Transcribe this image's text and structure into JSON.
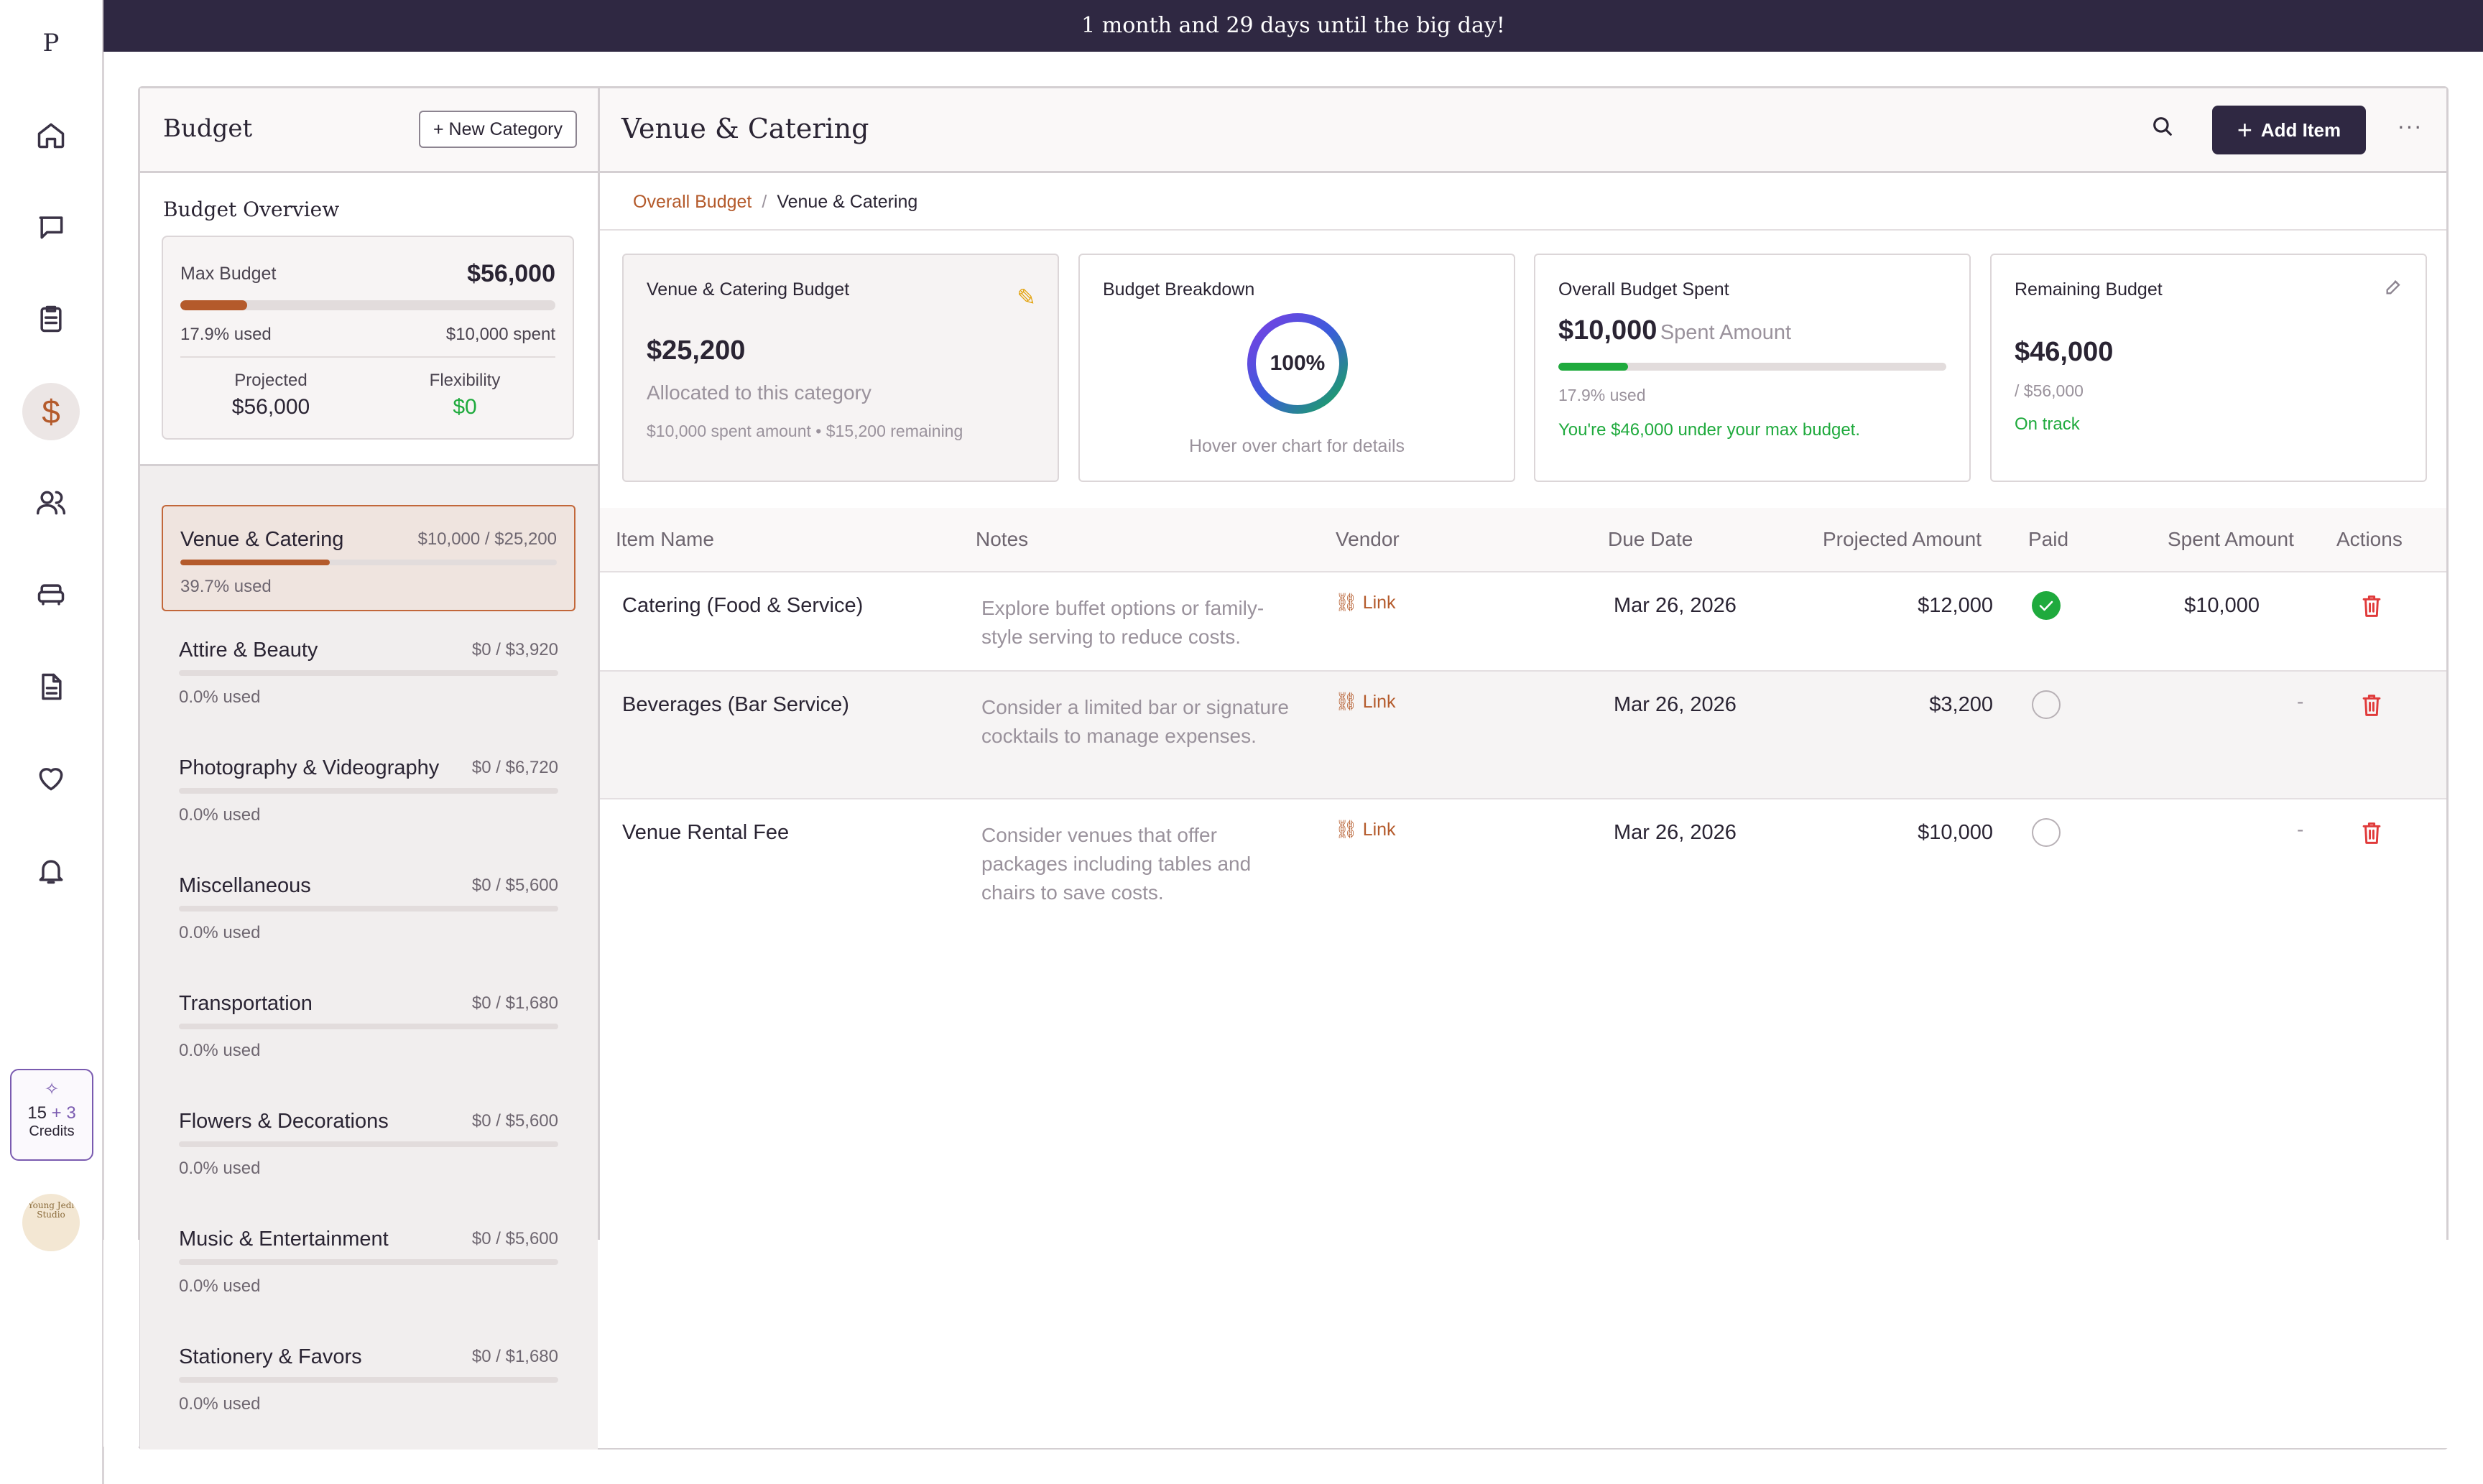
{
  "app": {
    "logo_letter": "P"
  },
  "banner": {
    "text": "1 month and 29 days until the big day!"
  },
  "rail": {
    "icons": [
      "home-icon",
      "chat-icon",
      "checklist-icon",
      "dollar-icon",
      "guests-icon",
      "vendors-icon",
      "document-icon",
      "heart-icon",
      "bell-icon"
    ],
    "active": "dollar-icon",
    "credits": {
      "base": "15",
      "plus_sign": "+",
      "bonus": "3",
      "label": "Credits"
    },
    "avatar_text": "Young Jedi Studio"
  },
  "sidebar": {
    "title": "Budget",
    "new_category_label": "+ New Category",
    "overview": {
      "title": "Budget Overview",
      "max_budget_label": "Max Budget",
      "max_budget_value": "$56,000",
      "used_fraction": 0.179,
      "used_text": "17.9% used",
      "spent_text": "$10,000 spent",
      "projected_label": "Projected",
      "projected_value": "$56,000",
      "flexibility_label": "Flexibility",
      "flexibility_value": "$0"
    },
    "categories": [
      {
        "name": "Venue & Catering",
        "amount": "$10,000 / $25,200",
        "used_text": "39.7% used",
        "used_fraction": 0.397,
        "active": true
      },
      {
        "name": "Attire & Beauty",
        "amount": "$0 / $3,920",
        "used_text": "0.0% used",
        "used_fraction": 0
      },
      {
        "name": "Photography & Videography",
        "amount": "$0 / $6,720",
        "used_text": "0.0% used",
        "used_fraction": 0
      },
      {
        "name": "Miscellaneous",
        "amount": "$0 / $5,600",
        "used_text": "0.0% used",
        "used_fraction": 0
      },
      {
        "name": "Transportation",
        "amount": "$0 / $1,680",
        "used_text": "0.0% used",
        "used_fraction": 0
      },
      {
        "name": "Flowers & Decorations",
        "amount": "$0 / $5,600",
        "used_text": "0.0% used",
        "used_fraction": 0
      },
      {
        "name": "Music & Entertainment",
        "amount": "$0 / $5,600",
        "used_text": "0.0% used",
        "used_fraction": 0
      },
      {
        "name": "Stationery & Favors",
        "amount": "$0 / $1,680",
        "used_text": "0.0% used",
        "used_fraction": 0
      }
    ]
  },
  "main": {
    "title": "Venue & Catering",
    "add_item_label": "Add Item",
    "breadcrumb": {
      "root": "Overall Budget",
      "separator": "/",
      "current": "Venue & Catering"
    },
    "cards": {
      "category_budget": {
        "label": "Venue & Catering Budget",
        "value": "$25,200",
        "sub": "Allocated to this category",
        "detail": "$10,000 spent amount • $15,200 remaining"
      },
      "breakdown": {
        "label": "Budget Breakdown",
        "percent_text": "100%",
        "hint": "Hover over chart for details"
      },
      "overall_spent": {
        "label": "Overall Budget Spent",
        "value": "$10,000",
        "value_suffix": "Spent Amount",
        "used_fraction": 0.179,
        "used_text": "17.9% used",
        "status": "You're $46,000 under your max budget."
      },
      "remaining": {
        "label": "Remaining Budget",
        "value": "$46,000",
        "of_total": "/ $56,000",
        "status": "On track"
      }
    },
    "table": {
      "headers": [
        "Item Name",
        "Notes",
        "Vendor",
        "Due Date",
        "Projected Amount",
        "Paid",
        "Spent Amount",
        "Actions"
      ],
      "rows": [
        {
          "name": "Catering (Food & Service)",
          "notes": "Explore buffet options or family-style serving to reduce costs.",
          "vendor": "Link",
          "due": "Mar 26, 2026",
          "projected": "$12,000",
          "paid": true,
          "spent": "$10,000"
        },
        {
          "name": "Beverages (Bar Service)",
          "notes": "Consider a limited bar or signature cocktails to manage expenses.",
          "vendor": "Link",
          "due": "Mar 26, 2026",
          "projected": "$3,200",
          "paid": false,
          "spent": "-"
        },
        {
          "name": "Venue Rental Fee",
          "notes": "Consider venues that offer packages including tables and chairs to save costs.",
          "vendor": "Link",
          "due": "Mar 26, 2026",
          "projected": "$10,000",
          "paid": false,
          "spent": "-"
        }
      ]
    }
  },
  "colors": {
    "accent": "#b45a2b",
    "dark": "#2f2842",
    "success": "#1faa3d",
    "danger": "#e03a3a",
    "credits": "#7a5bb0"
  }
}
